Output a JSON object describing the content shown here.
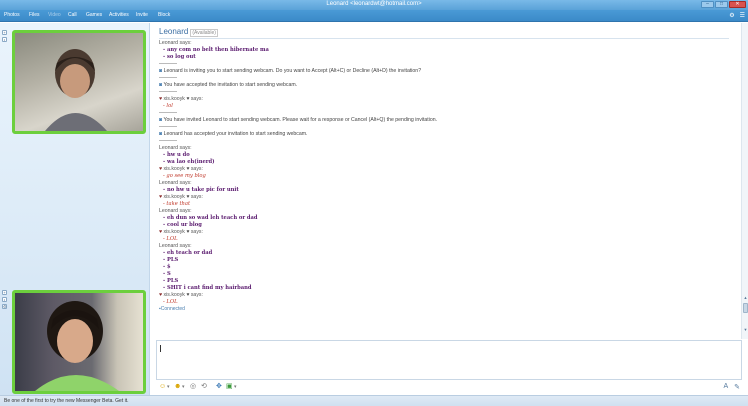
{
  "window": {
    "title": "Leonard <leonardwt@hotmail.com>",
    "buttons": [
      "–",
      "□",
      "✕"
    ]
  },
  "menu": {
    "items": [
      {
        "label": "Photos",
        "enabled": true
      },
      {
        "label": "Files",
        "enabled": true
      },
      {
        "label": "Video",
        "enabled": false
      },
      {
        "label": "Call",
        "enabled": true
      },
      {
        "label": "Games",
        "enabled": true
      },
      {
        "label": "Activities",
        "enabled": true
      },
      {
        "label": "Invite",
        "enabled": true
      },
      {
        "label": "Block",
        "enabled": true
      }
    ]
  },
  "contact": {
    "name": "Leonard",
    "status": "(Available)"
  },
  "log": {
    "top_fragment": "Leonard says:",
    "first_block": [
      "any com no belt then hibernate ma",
      "so log out"
    ],
    "system_invite": "Leonard is inviting you to start sending webcam. Do you want to Accept (Alt+C) or Decline (Alt+D) the invitation?",
    "system_accepted": "You have accepted the invitation to start sending webcam.",
    "me_name": "xis.kooyk ♥ says:",
    "me_lol": "lol",
    "system_invited": "You have invited Leonard to start sending webcam. Please wait for a response or Cancel (Alt+Q) the pending invitation.",
    "system_he_accepted": "Leonard has accepted your invitation to start sending webcam.",
    "leonard_name": "Leonard says:",
    "block_a": [
      "hw u do",
      "wa lao eh(inerd)"
    ],
    "me_a": "go see my blog",
    "block_b": [
      "no hw u take pic for unit"
    ],
    "me_b": "take that",
    "block_c": [
      "eh dun so wad leh teach or dad",
      "cool ur blog"
    ],
    "me_c": "LOL",
    "block_d": [
      "eh teach or dad",
      "PLS",
      "$",
      "S",
      "PLS",
      "SHIT i cant find my hairband"
    ],
    "me_d": "LOL",
    "connected": "Connected"
  },
  "footer": {
    "text": "Be one of the first to try the new Messenger Beta.   Get it."
  }
}
